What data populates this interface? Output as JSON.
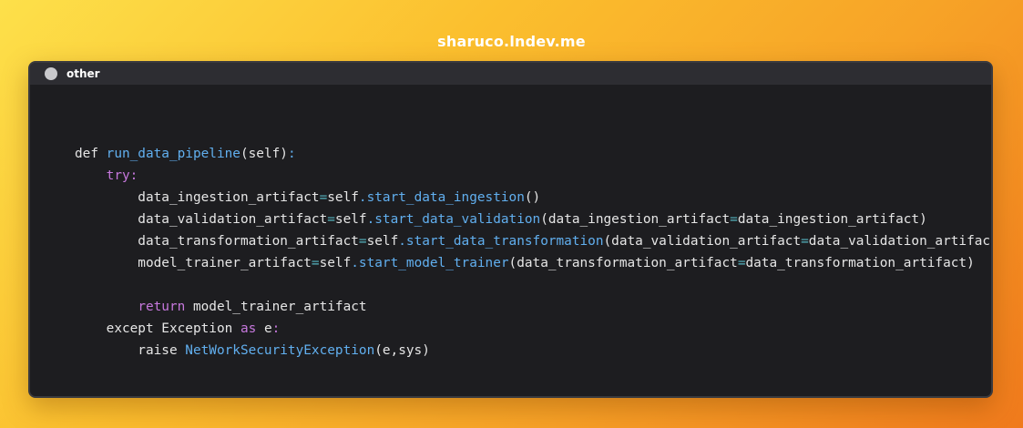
{
  "header": {
    "site_url": "sharuco.lndev.me"
  },
  "window": {
    "tab_label": "other",
    "tab_icon": "circle-icon"
  },
  "colors": {
    "plain": "#e6e6e6",
    "keyword": "#c678dd",
    "function": "#61afef",
    "operator": "#56b6c2",
    "editor_background": "#1d1d20"
  },
  "code": {
    "language": "python",
    "lines": [
      [],
      [
        {
          "t": "def ",
          "c": "plain"
        },
        {
          "t": "run_data_pipeline",
          "c": "function"
        },
        {
          "t": "(self)",
          "c": "plain"
        },
        {
          "t": ":",
          "c": "function"
        }
      ],
      [
        {
          "t": "    ",
          "c": "plain"
        },
        {
          "t": "try:",
          "c": "keyword"
        }
      ],
      [
        {
          "t": "        data_ingestion_artifact",
          "c": "plain"
        },
        {
          "t": "=",
          "c": "operator"
        },
        {
          "t": "self",
          "c": "plain"
        },
        {
          "t": ".",
          "c": "function"
        },
        {
          "t": "start_data_ingestion",
          "c": "function"
        },
        {
          "t": "()",
          "c": "plain"
        }
      ],
      [
        {
          "t": "        data_validation_artifact",
          "c": "plain"
        },
        {
          "t": "=",
          "c": "operator"
        },
        {
          "t": "self",
          "c": "plain"
        },
        {
          "t": ".",
          "c": "function"
        },
        {
          "t": "start_data_validation",
          "c": "function"
        },
        {
          "t": "(data_ingestion_artifact",
          "c": "plain"
        },
        {
          "t": "=",
          "c": "operator"
        },
        {
          "t": "data_ingestion_artifact)",
          "c": "plain"
        }
      ],
      [
        {
          "t": "        data_transformation_artifact",
          "c": "plain"
        },
        {
          "t": "=",
          "c": "operator"
        },
        {
          "t": "self",
          "c": "plain"
        },
        {
          "t": ".",
          "c": "function"
        },
        {
          "t": "start_data_transformation",
          "c": "function"
        },
        {
          "t": "(data_validation_artifact",
          "c": "plain"
        },
        {
          "t": "=",
          "c": "operator"
        },
        {
          "t": "data_validation_artifact)",
          "c": "plain"
        }
      ],
      [
        {
          "t": "        model_trainer_artifact",
          "c": "plain"
        },
        {
          "t": "=",
          "c": "operator"
        },
        {
          "t": "self",
          "c": "plain"
        },
        {
          "t": ".",
          "c": "function"
        },
        {
          "t": "start_model_trainer",
          "c": "function"
        },
        {
          "t": "(data_transformation_artifact",
          "c": "plain"
        },
        {
          "t": "=",
          "c": "operator"
        },
        {
          "t": "data_transformation_artifact)",
          "c": "plain"
        }
      ],
      [],
      [
        {
          "t": "        ",
          "c": "plain"
        },
        {
          "t": "return",
          "c": "keyword"
        },
        {
          "t": " model_trainer_artifact",
          "c": "plain"
        }
      ],
      [
        {
          "t": "    except Exception ",
          "c": "plain"
        },
        {
          "t": "as",
          "c": "keyword"
        },
        {
          "t": " e",
          "c": "plain"
        },
        {
          "t": ":",
          "c": "keyword"
        }
      ],
      [
        {
          "t": "        raise ",
          "c": "plain"
        },
        {
          "t": "NetWorkSecurityException",
          "c": "function"
        },
        {
          "t": "(e,sys)",
          "c": "plain"
        }
      ]
    ]
  }
}
